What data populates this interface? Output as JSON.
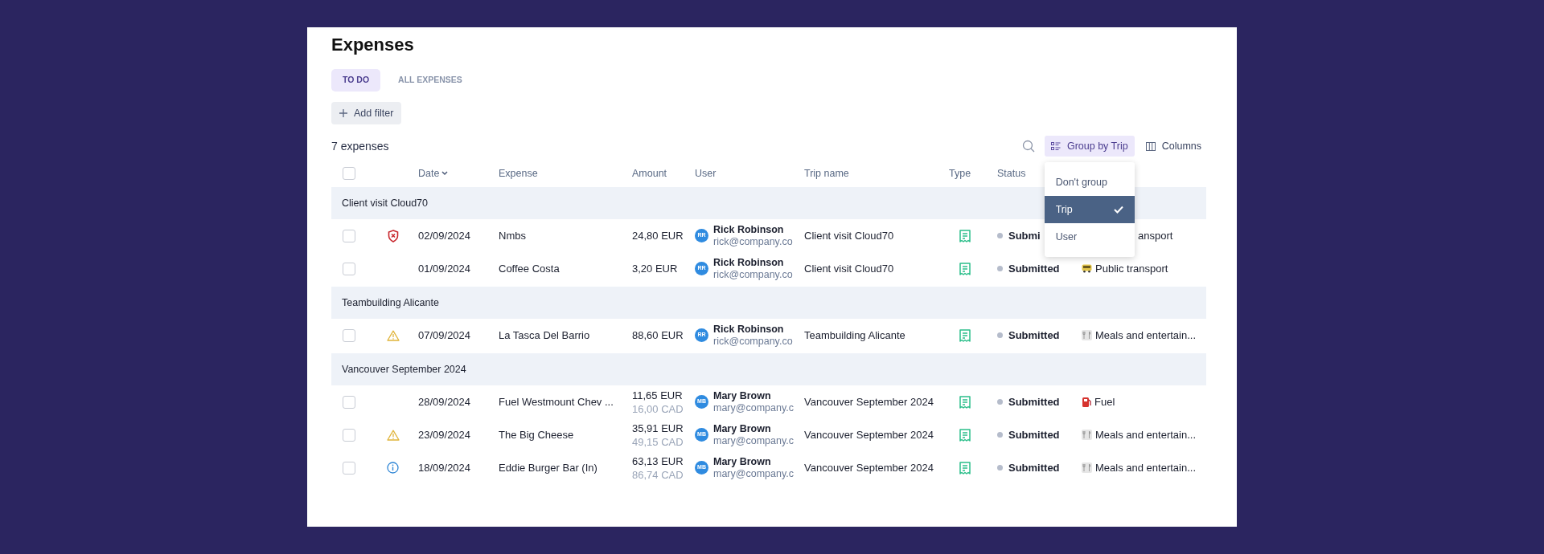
{
  "title": "Expenses",
  "tabs": [
    {
      "label": "TO DO",
      "selected": true
    },
    {
      "label": "ALL EXPENSES",
      "selected": false
    }
  ],
  "add_filter": "Add filter",
  "count": "7 expenses",
  "group_by": {
    "label": "Group by Trip",
    "expanded": true,
    "options": [
      {
        "label": "Don't group",
        "selected": false
      },
      {
        "label": "Trip",
        "selected": true
      },
      {
        "label": "User",
        "selected": false
      }
    ]
  },
  "columns_button": "Columns",
  "table": {
    "select_all": {
      "checked": false
    },
    "columns": [
      "Date",
      "Expense",
      "Amount",
      "User",
      "Trip name",
      "Type",
      "Status"
    ],
    "groups": [
      {
        "name": "Client visit Cloud70",
        "rows": [
          {
            "checked": false,
            "flag": {
              "kind": "blocked"
            },
            "date": "02/09/2024",
            "expense": "Nmbs",
            "amount": "24,80 EUR",
            "initials": "RR",
            "user": "Rick Robinson",
            "email": "rick@company.co",
            "trip": "Client visit Cloud70",
            "type": {
              "kind": "receipt"
            },
            "status": "Submi",
            "category": {
              "label": "ansport"
            }
          },
          {
            "checked": false,
            "date": "01/09/2024",
            "expense": "Coffee Costa",
            "amount": "3,20 EUR",
            "initials": "RR",
            "user": "Rick Robinson",
            "email": "rick@company.co",
            "trip": "Client visit Cloud70",
            "type": {
              "kind": "receipt"
            },
            "status": "Submitted",
            "category": {
              "kind": "bus",
              "label": "Public transport"
            }
          }
        ]
      },
      {
        "name": "Teambuilding Alicante",
        "rows": [
          {
            "checked": false,
            "flag": {
              "kind": "warning"
            },
            "date": "07/09/2024",
            "expense": "La Tasca Del Barrio",
            "amount": "88,60 EUR",
            "initials": "RR",
            "user": "Rick Robinson",
            "email": "rick@company.co",
            "trip": "Teambuilding Alicante",
            "type": {
              "kind": "receipt"
            },
            "status": "Submitted",
            "category": {
              "kind": "meals",
              "label": "Meals and entertain..."
            }
          }
        ]
      },
      {
        "name": "Vancouver September 2024",
        "rows": [
          {
            "checked": false,
            "date": "28/09/2024",
            "expense": "Fuel Westmount Chev ...",
            "amount": "11,65 EUR",
            "amount_original": "16,00 CAD",
            "initials": "MB",
            "user": "Mary Brown",
            "email": "mary@company.c",
            "trip": "Vancouver September 2024",
            "type": {
              "kind": "receipt"
            },
            "status": "Submitted",
            "category": {
              "kind": "fuel",
              "label": "Fuel"
            }
          },
          {
            "checked": false,
            "flag": {
              "kind": "warning"
            },
            "date": "23/09/2024",
            "expense": "The Big Cheese",
            "amount": "35,91 EUR",
            "amount_original": "49,15 CAD",
            "initials": "MB",
            "user": "Mary Brown",
            "email": "mary@company.c",
            "trip": "Vancouver September 2024",
            "type": {
              "kind": "receipt"
            },
            "status": "Submitted",
            "category": {
              "kind": "meals",
              "label": "Meals and entertain..."
            }
          },
          {
            "checked": false,
            "flag": {
              "kind": "info"
            },
            "date": "18/09/2024",
            "expense": "Eddie Burger Bar (In)",
            "amount": "63,13 EUR",
            "amount_original": "86,74 CAD",
            "initials": "MB",
            "user": "Mary Brown",
            "email": "mary@company.c",
            "trip": "Vancouver September 2024",
            "type": {
              "kind": "receipt"
            },
            "status": "Submitted",
            "category": {
              "kind": "meals",
              "label": "Meals and entertain..."
            }
          }
        ]
      }
    ]
  }
}
